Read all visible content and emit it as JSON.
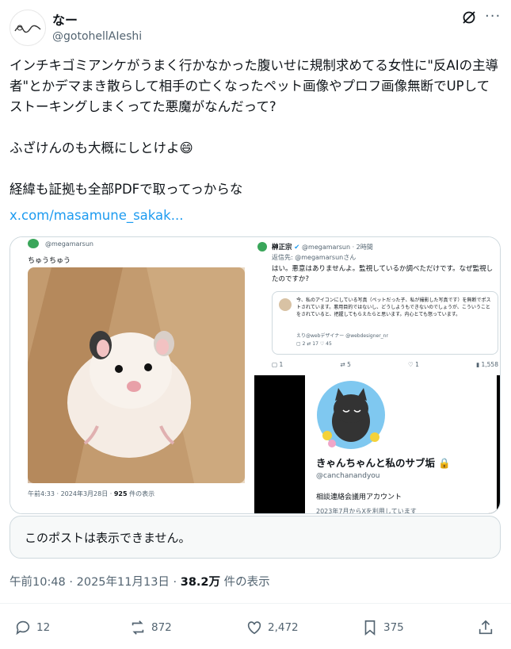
{
  "author": {
    "name": "なー",
    "handle": "@gotohellAIeshi"
  },
  "post": {
    "text": "インチキゴミアンケがうまく行かなかった腹いせに規制求めてる女性に\"反AIの主導者\"とかデマまき散らして相手の亡くなったペット画像やプロフ画像無断でUPしてストーキングしまくってた悪魔がなんだって?\n\nふざけんのも大概にしとけよ😄\n\n経緯も証拠も全部PDFで取ってっからな",
    "link": "x.com/masamune_sakak..."
  },
  "media": {
    "left_card": {
      "handle": "@megamarsun",
      "caption": "ちゅうちゅう",
      "footer_time": "午前4:33 · 2024年3月28日 ·",
      "footer_views": "925",
      "footer_views_label": "件の表示"
    },
    "right_top": {
      "name": "榊正宗",
      "handle": "@megamarsun · 2時間",
      "reply_to": "返信先: @megamarsunさん",
      "reply_text": "はい。悪意はありませんよ。監視しているか調べただけです。なぜ監視したのですか?",
      "quote_text": "今、私のアイコンにしている写真（ペットだった子、私が撮影した写真です）を無断でポストされています。悪用目的ではないし、どうしようもできないのでしょうが、こういうことをされていると、把握してもらえたらと思います。内心とても怒っています。",
      "quote_author": "えり@webデザイナー @webdesigner_nr",
      "quote_counts": [
        "2",
        "17",
        "45"
      ],
      "counts": [
        "1",
        "5",
        "1",
        "1,558"
      ]
    },
    "right_bottom": {
      "profile_name": "きゃんちゃんと私のサブ垢",
      "profile_handle": "@canchanandyou",
      "profile_bio": "相談連絡会議用アカウント",
      "profile_extra": "2023年7月からXを利用しています"
    }
  },
  "quoted_post": {
    "text": "このポストは表示できません。"
  },
  "meta": {
    "time": "午前10:48 · 2025年11月13日 ·",
    "views": "38.2万",
    "views_label": "件の表示"
  },
  "actions": {
    "replies": "12",
    "reposts": "872",
    "likes": "2,472",
    "bookmarks": "375"
  },
  "colors": {
    "link": "#1d9bf0",
    "secondary": "#536471",
    "border": "#cfd9de"
  }
}
